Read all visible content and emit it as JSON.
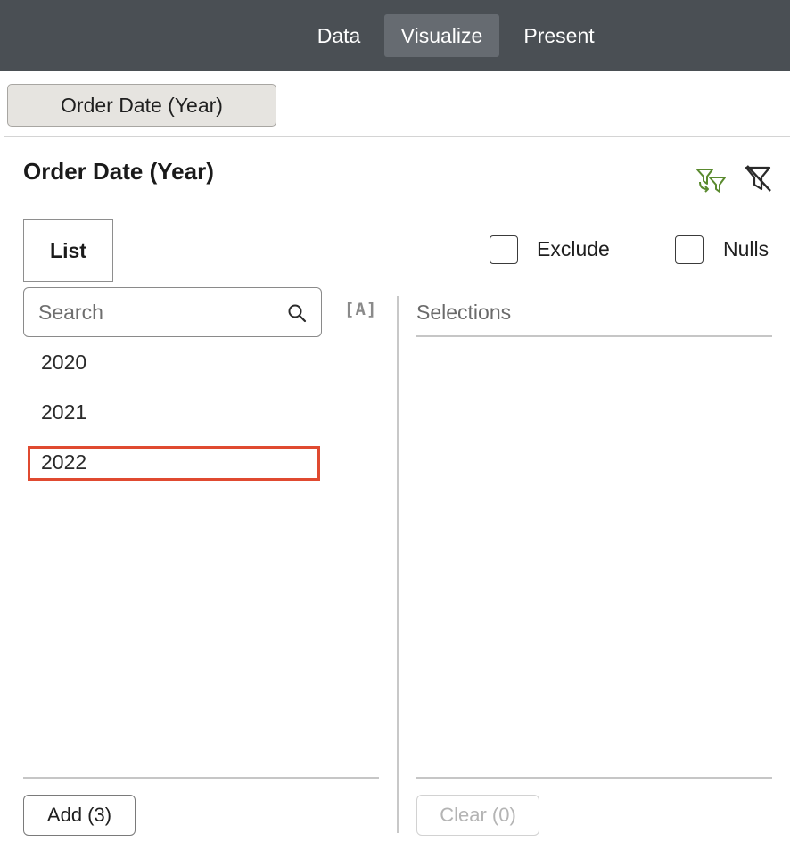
{
  "nav": {
    "tabs": [
      {
        "label": "Data"
      },
      {
        "label": "Visualize"
      },
      {
        "label": "Present"
      }
    ],
    "active": "Visualize"
  },
  "filter_bar": {
    "pill_label": "Order Date (Year)"
  },
  "panel": {
    "title": "Order Date (Year)",
    "tab_label": "List",
    "exclude_label": "Exclude",
    "nulls_label": "Nulls",
    "exclude_checked": false,
    "nulls_checked": false,
    "search_placeholder": "Search",
    "sort_icon_label": "[A]",
    "values": [
      "2020",
      "2021",
      "2022"
    ],
    "highlighted_value": "2022",
    "selections_header": "Selections",
    "add_button": "Add (3)",
    "clear_button": "Clear (0)"
  },
  "icons": {
    "settings": "filter-settings-icon",
    "clear_filter": "clear-filter-icon",
    "search": "search-icon"
  },
  "colors": {
    "topbar": "#4a4f54",
    "active_tab": "#666b71",
    "accent_green": "#5a8a2e",
    "highlight_red": "#e04a30"
  }
}
